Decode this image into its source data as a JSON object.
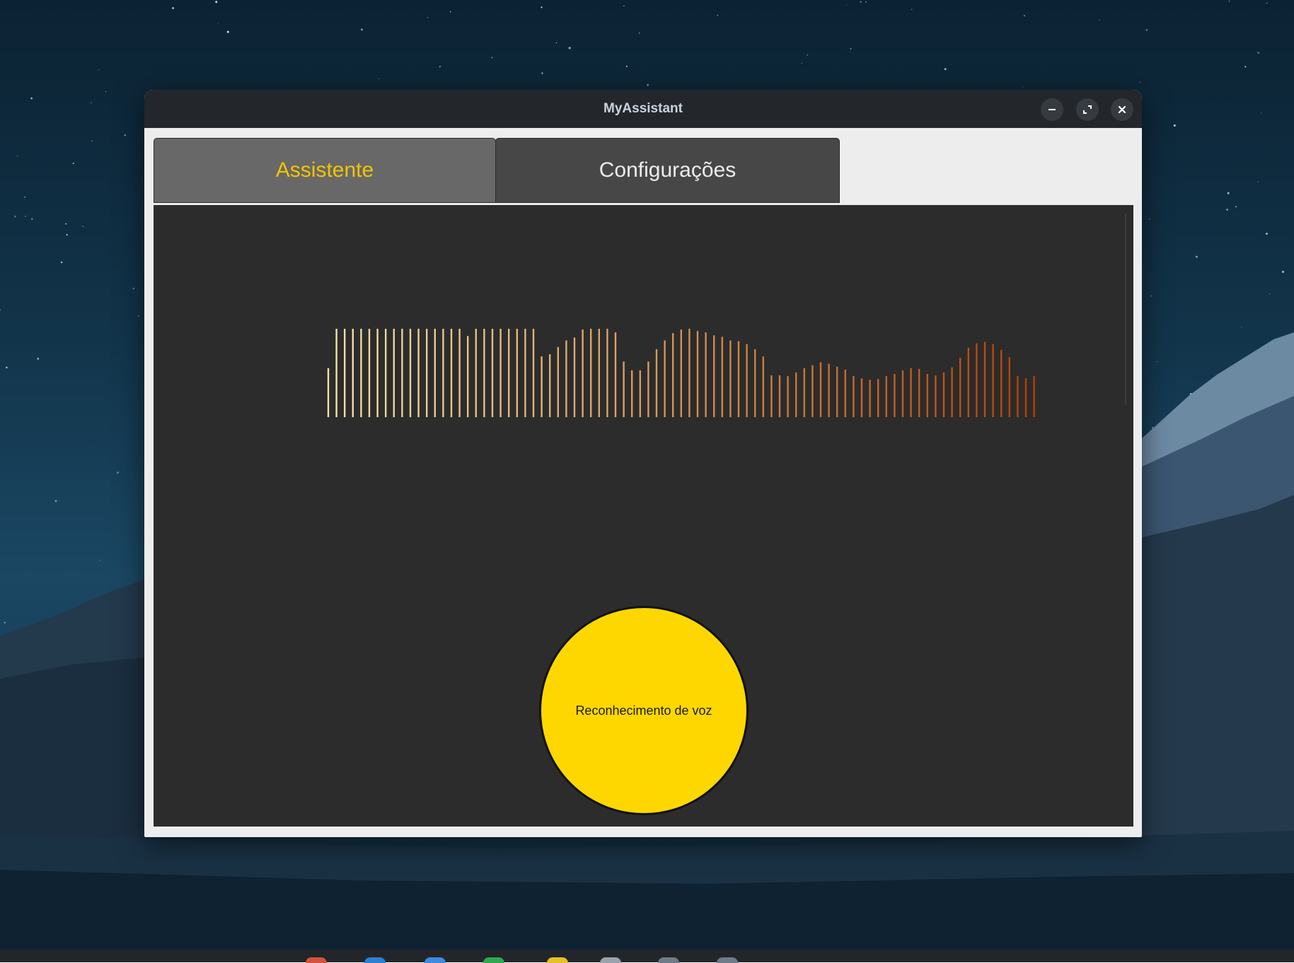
{
  "window": {
    "title": "MyAssistant"
  },
  "window_controls": {
    "minimize": "minimize-icon",
    "maximize": "maximize-icon",
    "close": "close-icon"
  },
  "tabs": [
    {
      "label": "Assistente",
      "active": true
    },
    {
      "label": "Configurações",
      "active": false
    }
  ],
  "visualizer": {
    "type": "audio-waveform-bars",
    "amplitudes": [
      0.46,
      1,
      1,
      1,
      1,
      1,
      1,
      1,
      1,
      1,
      1,
      1,
      1,
      1,
      1,
      1,
      1,
      0.9,
      1,
      1,
      1,
      1,
      1,
      1,
      1,
      1,
      0.62,
      0.65,
      0.75,
      0.84,
      0.88,
      0.99,
      1,
      1,
      1,
      0.95,
      0.55,
      0.43,
      0.43,
      0.55,
      0.72,
      0.84,
      0.94,
      0.99,
      1,
      0.97,
      0.95,
      0.91,
      0.89,
      0.84,
      0.83,
      0.79,
      0.72,
      0.62,
      0.36,
      0.36,
      0.35,
      0.4,
      0.46,
      0.5,
      0.54,
      0.52,
      0.48,
      0.44,
      0.35,
      0.32,
      0.3,
      0.31,
      0.35,
      0.38,
      0.43,
      0.46,
      0.45,
      0.38,
      0.36,
      0.4,
      0.47,
      0.6,
      0.74,
      0.8,
      0.82,
      0.79,
      0.71,
      0.61,
      0.35,
      0.32,
      0.35
    ],
    "color_start": "#f3e3a8",
    "color_end": "#b83f00"
  },
  "voice_button": {
    "label": "Reconhecimento de voz",
    "color": "#ffd700"
  },
  "colors": {
    "titlebar": "#23272b",
    "tab_active_text": "#f2c400",
    "content_background": "#2c2c2c"
  }
}
